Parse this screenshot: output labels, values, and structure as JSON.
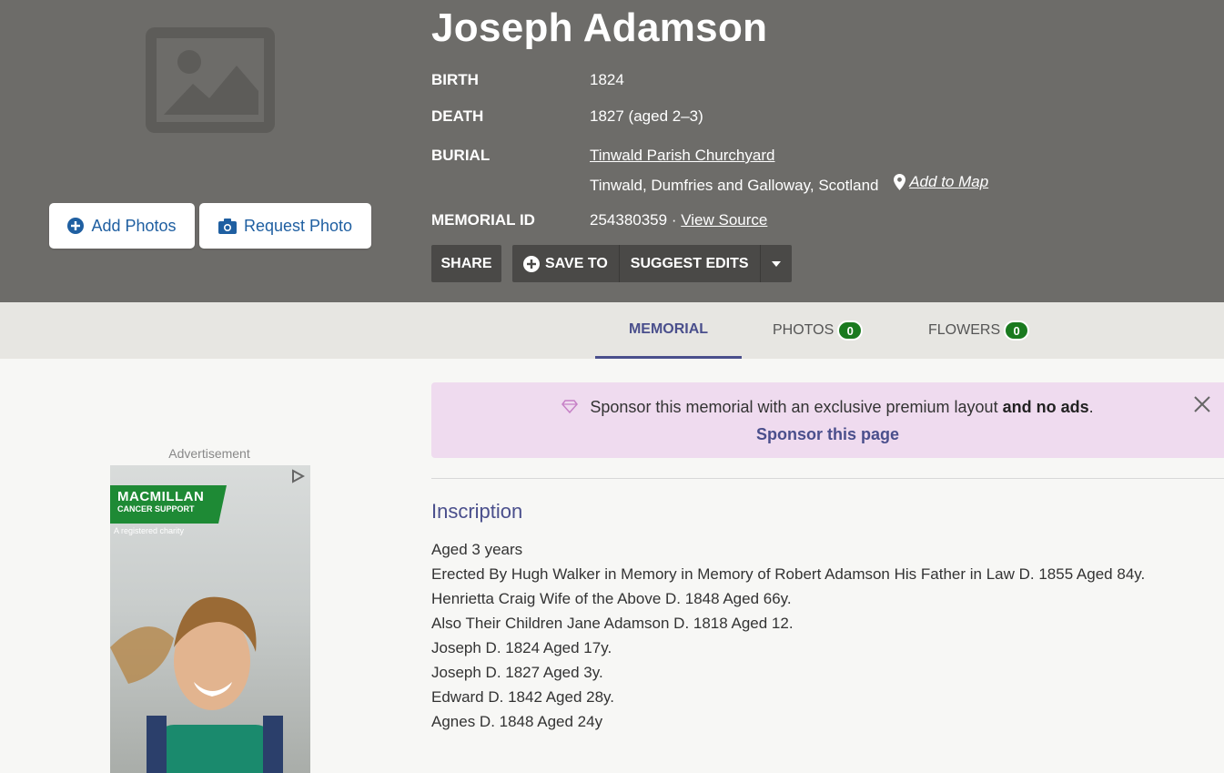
{
  "header": {
    "name": "Joseph Adamson",
    "add_photos_label": "Add Photos",
    "request_photo_label": "Request Photo",
    "facts": {
      "birth_label": "BIRTH",
      "birth_value": "1824",
      "death_label": "DEATH",
      "death_value": "1827 (aged 2–3)",
      "burial_label": "BURIAL",
      "burial_place": "Tinwald Parish Churchyard",
      "burial_location": "Tinwald, Dumfries and Galloway, Scotland",
      "add_to_map": "Add to Map",
      "memorial_id_label": "MEMORIAL ID",
      "memorial_id_value": "254380359 ·",
      "view_source": "View Source"
    },
    "actions": {
      "share": "SHARE",
      "save_to": "SAVE TO",
      "suggest_edits": "SUGGEST EDITS"
    }
  },
  "tabs": {
    "memorial": "MEMORIAL",
    "photos": "PHOTOS",
    "photos_count": "0",
    "flowers": "FLOWERS",
    "flowers_count": "0"
  },
  "advertisement": {
    "label": "Advertisement",
    "brand_line1": "MACMILLAN",
    "brand_line2": "CANCER SUPPORT",
    "registered": "A registered charity"
  },
  "sponsor": {
    "text": "Sponsor this memorial with an exclusive premium layout",
    "text_bold": "and no ads",
    "text_end": ".",
    "link": "Sponsor this page"
  },
  "inscription": {
    "title": "Inscription",
    "lines": [
      "Aged 3 years",
      "Erected By Hugh Walker in Memory in Memory of Robert Adamson His Father in Law D. 1855 Aged 84y.",
      "Henrietta Craig Wife of the Above D. 1848 Aged 66y.",
      "Also Their Children Jane Adamson D. 1818 Aged 12.",
      "Joseph D. 1824 Aged 17y.",
      "Joseph D. 1827 Aged 3y.",
      "Edward D. 1842 Aged 28y.",
      "Agnes D. 1848 Aged 24y"
    ]
  },
  "colors": {
    "header_bg": "#6d6c69",
    "accent": "#4a4f8c",
    "badge_green": "#1a7a1f",
    "sponsor_bg": "#efdbef",
    "link_blue": "#1f5fa1"
  }
}
